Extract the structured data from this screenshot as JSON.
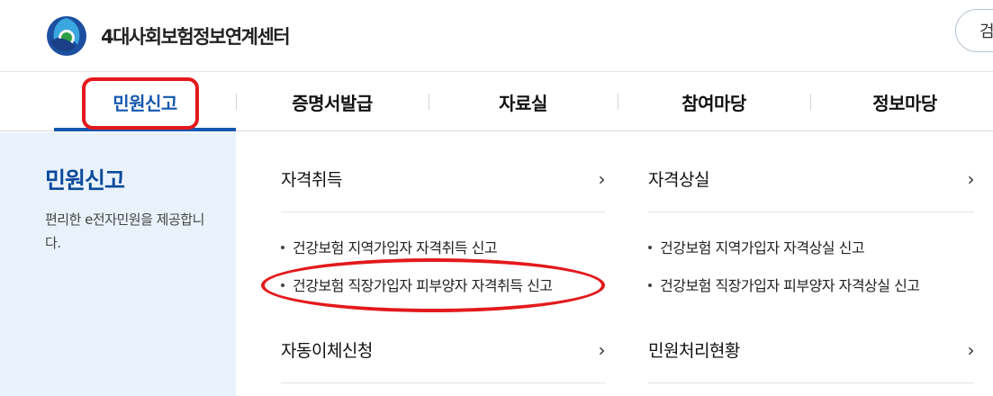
{
  "header": {
    "site_title": "4대사회보험정보연계센터",
    "search_label": "검색"
  },
  "gnb": {
    "items": [
      {
        "label": "민원신고",
        "active": true
      },
      {
        "label": "증명서발급"
      },
      {
        "label": "자료실"
      },
      {
        "label": "참여마당"
      },
      {
        "label": "정보마당"
      }
    ]
  },
  "side": {
    "title": "민원신고",
    "description": "편리한 e전자민원을 제공합니다."
  },
  "menu": {
    "col1": {
      "heading1": "자격취득",
      "links": [
        "건강보험 지역가입자 자격취득 신고",
        "건강보험 직장가입자 피부양자 자격취득 신고"
      ],
      "heading2": "자동이체신청"
    },
    "col2": {
      "heading1": "자격상실",
      "links": [
        "건강보험 지역가입자 자격상실 신고",
        "건강보험 직장가입자 피부양자 자격상실 신고"
      ],
      "heading2": "민원처리현황"
    }
  },
  "icons": {
    "chevron": "chevron-right-icon",
    "logo": "logo-emblem-icon"
  },
  "colors": {
    "accent": "#1558b0",
    "side_bg": "#e9f2fb",
    "annotation": "#e3191c"
  }
}
